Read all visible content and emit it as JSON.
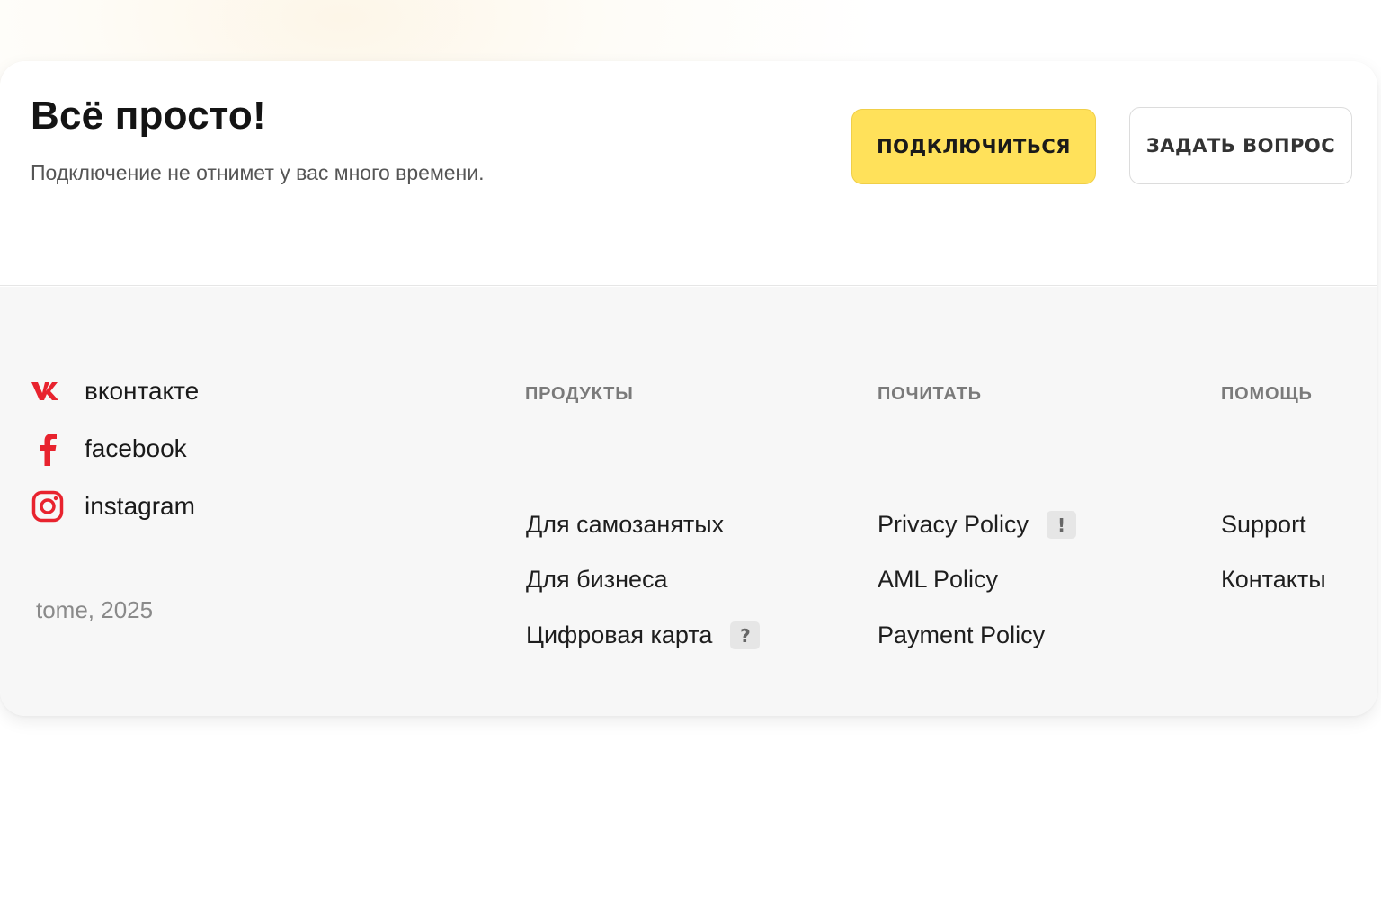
{
  "hero": {
    "title": "Всё просто!",
    "subtitle": "Подключение не отнимет у вас много времени.",
    "primary_button": "ПОДКЛЮЧИТЬСЯ",
    "secondary_button": "ЗАДАТЬ ВОПРОС"
  },
  "social": [
    {
      "label": "вконтакте",
      "icon": "vk-icon"
    },
    {
      "label": "facebook",
      "icon": "facebook-icon"
    },
    {
      "label": "instagram",
      "icon": "instagram-icon"
    }
  ],
  "copyright": "tome, 2025",
  "columns": {
    "products": {
      "heading": "ПРОДУКТЫ",
      "links": [
        {
          "label": "Для самозанятых"
        },
        {
          "label": "Для бизнеса"
        },
        {
          "label": "Цифровая карта",
          "badge": "?"
        }
      ]
    },
    "read": {
      "heading": "ПОЧИТАТЬ",
      "links": [
        {
          "label": "Privacy Policy",
          "badge": "!"
        },
        {
          "label": "AML Policy"
        },
        {
          "label": "Payment Policy"
        }
      ]
    },
    "help": {
      "heading": "ПОМОЩЬ",
      "links": [
        {
          "label": "Support"
        },
        {
          "label": "Контакты"
        }
      ]
    }
  },
  "colors": {
    "accent_yellow": "#ffe15a",
    "social_red": "#e8232e",
    "footer_bg": "#f7f7f7"
  }
}
